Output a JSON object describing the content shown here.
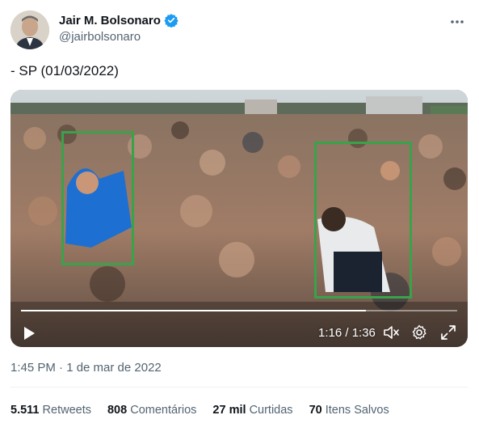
{
  "author": {
    "display_name": "Jair M. Bolsonaro",
    "handle": "@jairbolsonaro",
    "verified_color": "#1d9bf0",
    "avatar": "profile-photo"
  },
  "tweet": {
    "text": "- SP (01/03/2022)",
    "timestamp": "1:45 PM · 1 de mar de 2022"
  },
  "video": {
    "time_display": "1:16 / 1:36",
    "progress_fraction": 0.79,
    "highlight_color": "#3aa24a",
    "icons": [
      "play-icon",
      "mute-icon",
      "settings-gear-icon",
      "fullscreen-icon"
    ]
  },
  "stats": [
    {
      "value": "5.511",
      "label": "Retweets"
    },
    {
      "value": "808",
      "label": "Comentários"
    },
    {
      "value": "27 mil",
      "label": "Curtidas"
    },
    {
      "value": "70",
      "label": "Itens Salvos"
    }
  ]
}
